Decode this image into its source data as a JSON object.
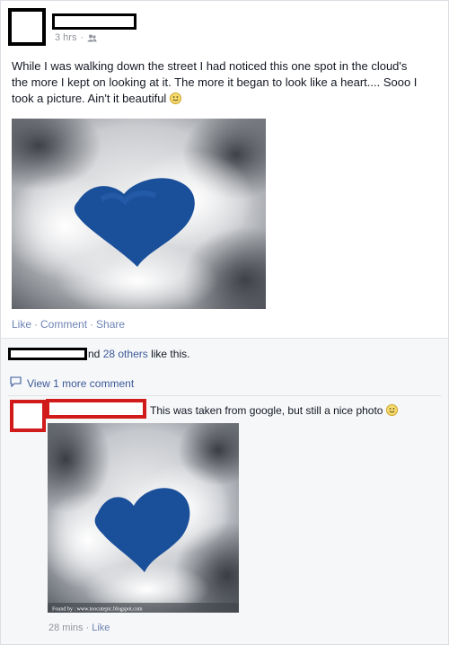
{
  "post": {
    "time": "3 hrs",
    "separator": "·",
    "privacy_icon": "friends-icon",
    "text": "While I was walking down the street I had noticed this one spot in the cloud's the more I kept on looking at it. The more it began to look like a heart.... Sooo I took a picture. Ain't it beautiful",
    "actions": {
      "like": "Like",
      "comment": "Comment",
      "share": "Share"
    }
  },
  "feedback": {
    "likes_prefix": "nd",
    "likes_others": "28 others",
    "likes_suffix": "like this.",
    "view_more": "View 1 more comment"
  },
  "comment": {
    "text": "This was taken from google, but still a nice photo",
    "photo_caption": "Found by : www.toocutepic.blogspot.com",
    "time": "28 mins",
    "like": "Like"
  },
  "colors": {
    "link": "#3b5998",
    "action": "#6d84b4",
    "redact_box": "#000000",
    "highlight_box": "#d11a1a",
    "sky": "#1a4f9a"
  }
}
